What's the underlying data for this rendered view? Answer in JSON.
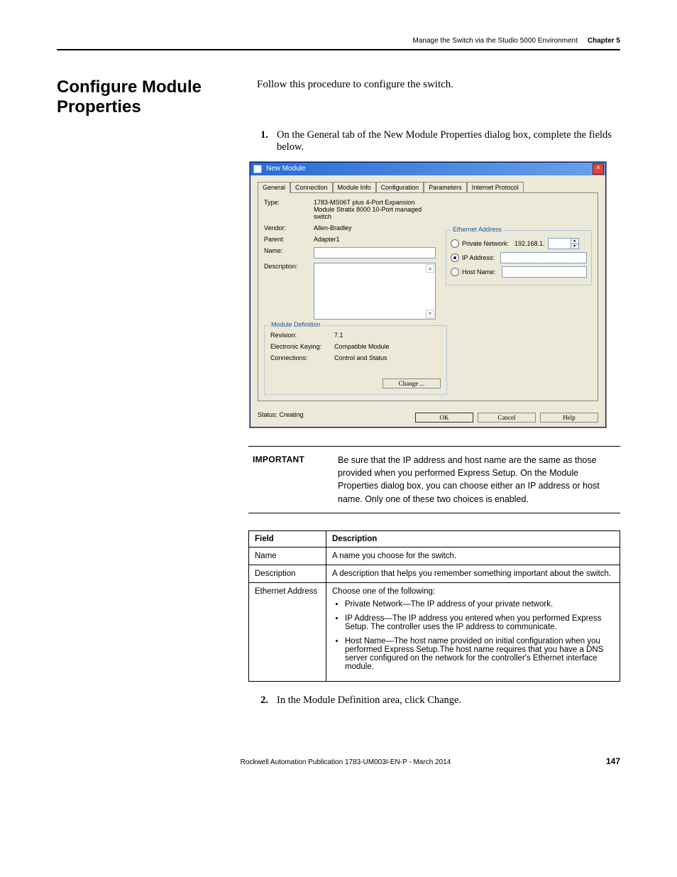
{
  "header": {
    "crumb": "Manage the Switch via the Studio 5000 Environment",
    "chapter": "Chapter 5"
  },
  "section": {
    "title": "Configure Module Properties",
    "intro": "Follow this procedure to configure the switch."
  },
  "steps": {
    "s1num": "1.",
    "s1": "On the General tab of the New Module Properties dialog box, complete the fields below.",
    "s2num": "2.",
    "s2": "In the Module Definition area, click Change."
  },
  "dialog": {
    "title": "New Module",
    "tabs": {
      "general": "General",
      "connection": "Connection",
      "moduleinfo": "Module Info",
      "configuration": "Configuration",
      "parameters": "Parameters",
      "internet": "Internet Protocol"
    },
    "labels": {
      "type": "Type:",
      "vendor": "Vendor:",
      "parent": "Parent:",
      "name": "Name:",
      "description": "Description:"
    },
    "values": {
      "type": "1783-MS06T plus 4-Port Expansion Module Stratix 8000 10-Port managed switch",
      "vendor": "Allen-Bradley",
      "parent": "Adapter1"
    },
    "ethernet": {
      "legend": "Ethernet Address",
      "private": "Private Network:",
      "private_ip": "192.168.1.",
      "ip": "IP Address:",
      "host": "Host Name:"
    },
    "moddef": {
      "legend": "Module Definition",
      "revision_l": "Revision:",
      "revision_v": "7.1",
      "ek_l": "Electronic Keying:",
      "ek_v": "Compatible Module",
      "conn_l": "Connections:",
      "conn_v": "Control and Status",
      "change": "Change ..."
    },
    "status_l": "Status:",
    "status_v": "Creating",
    "btn_ok": "OK",
    "btn_cancel": "Cancel",
    "btn_help": "Help"
  },
  "important": {
    "label": "IMPORTANT",
    "text": "Be sure that the IP address and host name are the same as those provided when you performed Express Setup. On the Module Properties dialog box, you can choose either an IP address or host name. Only one of these two choices is enabled."
  },
  "table": {
    "h1": "Field",
    "h2": "Description",
    "r1f": "Name",
    "r1d": "A name you choose for the switch.",
    "r2f": "Description",
    "r2d": "A description that helps you remember something important about the switch.",
    "r3f": "Ethernet Address",
    "r3intro": "Choose one of the following:",
    "r3b1": "Private Network—The IP address of your private network.",
    "r3b2": "IP Address—The IP address you entered when you performed Express Setup. The controller uses the IP address to communicate.",
    "r3b3": "Host Name—The host name provided on initial configuration when you performed Express Setup.The host name requires that you have a DNS server configured on the network for the controller's Ethernet interface module."
  },
  "footer": {
    "pub": "Rockwell Automation Publication 1783-UM003I-EN-P - March 2014",
    "page": "147"
  }
}
